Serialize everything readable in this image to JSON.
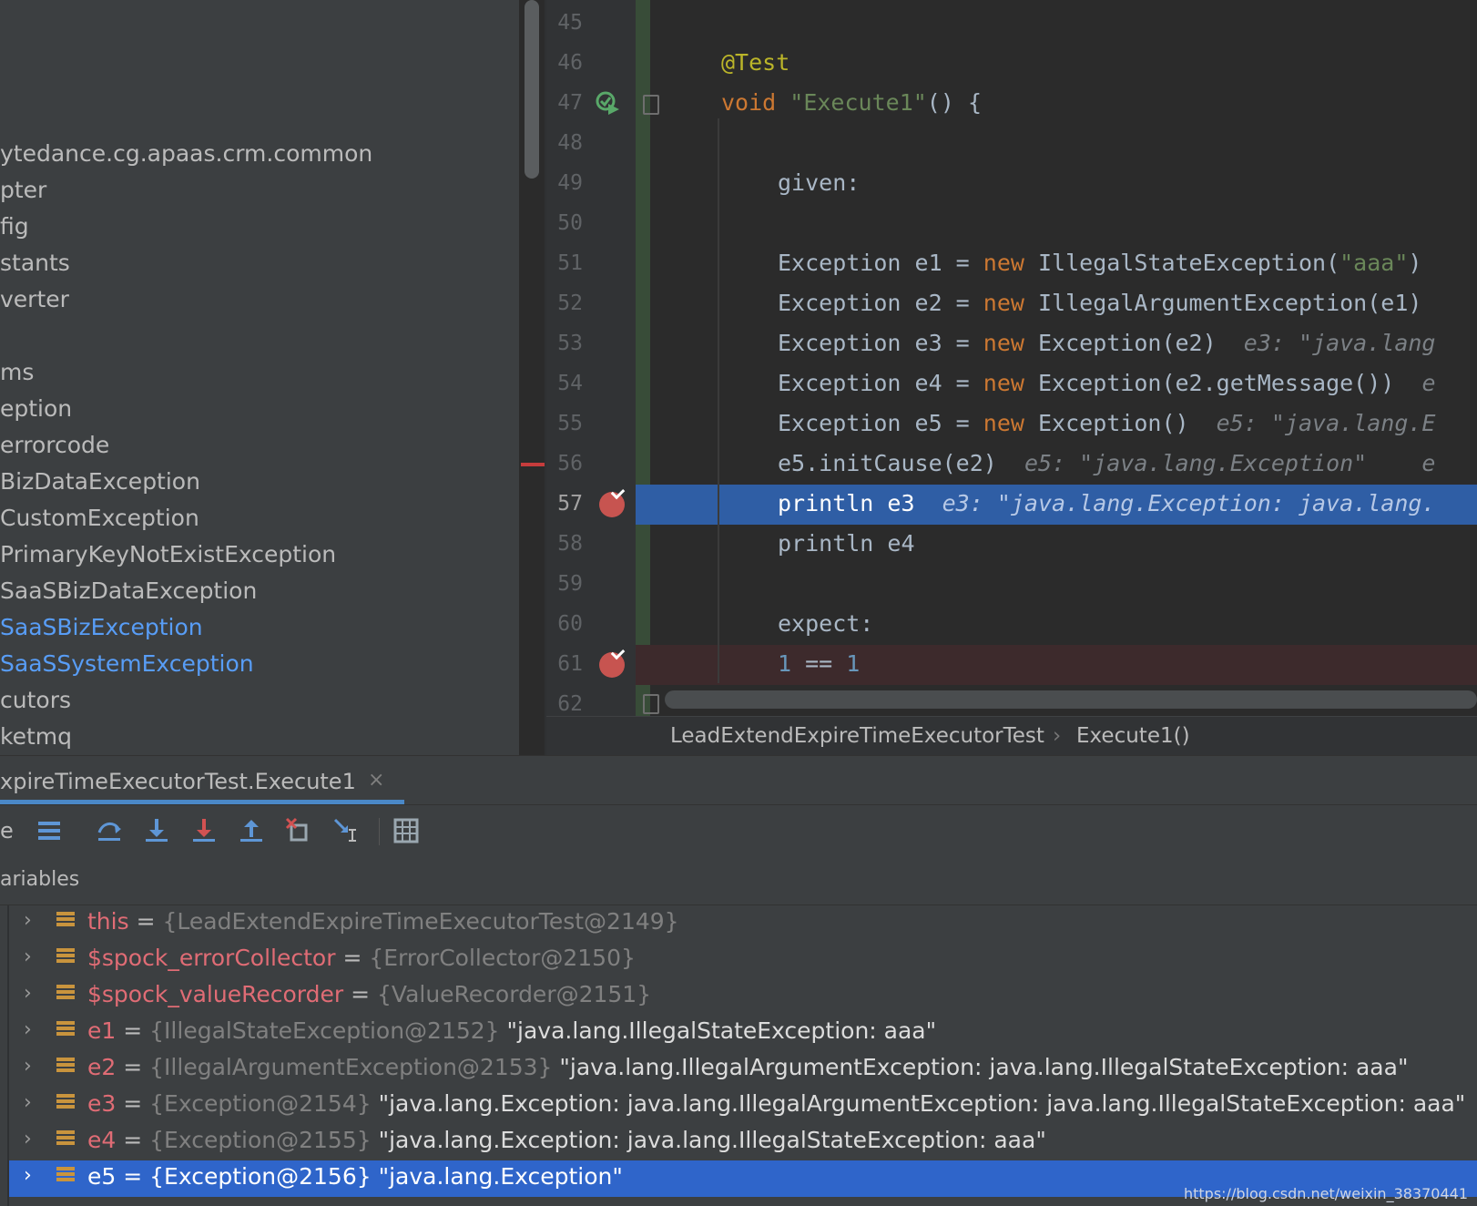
{
  "project_tree": {
    "items": [
      {
        "label": "ytedance.cg.apaas.crm.common",
        "linked": false
      },
      {
        "label": "pter",
        "linked": false
      },
      {
        "label": "fig",
        "linked": false
      },
      {
        "label": "stants",
        "linked": false
      },
      {
        "label": "verter",
        "linked": false
      },
      {
        "label": "",
        "linked": false
      },
      {
        "label": "ms",
        "linked": false
      },
      {
        "label": "eption",
        "linked": false
      },
      {
        "label": "errorcode",
        "linked": false
      },
      {
        "label": "BizDataException",
        "linked": false
      },
      {
        "label": "CustomException",
        "linked": false
      },
      {
        "label": "PrimaryKeyNotExistException",
        "linked": false
      },
      {
        "label": "SaaSBizDataException",
        "linked": false
      },
      {
        "label": "SaaSBizException",
        "linked": true
      },
      {
        "label": "SaaSSystemException",
        "linked": true
      },
      {
        "label": "cutors",
        "linked": false
      },
      {
        "label": "ketmq",
        "linked": false
      }
    ]
  },
  "editor": {
    "lines": [
      {
        "num": "45",
        "code": ""
      },
      {
        "num": "46",
        "code": "@Test"
      },
      {
        "num": "47",
        "code": "void \"Execute1\"() {"
      },
      {
        "num": "48",
        "code": ""
      },
      {
        "num": "49",
        "code": "given:"
      },
      {
        "num": "50",
        "code": ""
      },
      {
        "num": "51",
        "code": "Exception e1 = new IllegalStateException(\"aaa\")"
      },
      {
        "num": "52",
        "code": "Exception e2 = new IllegalArgumentException(e1)"
      },
      {
        "num": "53",
        "code": "Exception e3 = new Exception(e2)",
        "inlay": "e3: \"java.lang"
      },
      {
        "num": "54",
        "code": "Exception e4 = new Exception(e2.getMessage())",
        "inlay": "e"
      },
      {
        "num": "55",
        "code": "Exception e5 = new Exception()",
        "inlay": "e5: \"java.lang.E"
      },
      {
        "num": "56",
        "code": "e5.initCause(e2)",
        "inlay": "e5: \"java.lang.Exception\"    e"
      },
      {
        "num": "57",
        "code": "println e3",
        "inlay": "e3: \"java.lang.Exception: java.lang."
      },
      {
        "num": "58",
        "code": "println e4"
      },
      {
        "num": "59",
        "code": ""
      },
      {
        "num": "60",
        "code": "expect:"
      },
      {
        "num": "61",
        "code": "1 == 1"
      },
      {
        "num": "62",
        "code": ""
      }
    ],
    "colors": {
      "keyword": "#cc7832",
      "string": "#6a8759",
      "annotation": "#bbb529",
      "number": "#6897bb",
      "execution_line": "#2f5ea5",
      "breakpoint": "#c75450"
    }
  },
  "breadcrumb": {
    "class_name": "LeadExtendExpireTimeExecutorTest",
    "separator": "›",
    "method": "Execute1()"
  },
  "debug": {
    "tab_label": "xpireTimeExecutorTest.Execute1",
    "tab_close": "×",
    "toolbar_edge_label": "e",
    "toolbar_icons": [
      "show-execution-point-icon",
      "step-over-icon",
      "step-into-icon",
      "force-step-into-icon",
      "step-out-icon",
      "drop-frame-icon",
      "run-to-cursor-icon",
      "evaluate-expression-icon"
    ],
    "variables_title": "ariables",
    "variables": [
      {
        "name": "this",
        "eq": "=",
        "type": "{LeadExtendExpireTimeExecutorTest@2149}",
        "value": ""
      },
      {
        "name": "$spock_errorCollector",
        "eq": "=",
        "type": "{ErrorCollector@2150}",
        "value": ""
      },
      {
        "name": "$spock_valueRecorder",
        "eq": "=",
        "type": "{ValueRecorder@2151}",
        "value": ""
      },
      {
        "name": "e1",
        "eq": "=",
        "type": "{IllegalStateException@2152}",
        "value": "\"java.lang.IllegalStateException: aaa\""
      },
      {
        "name": "e2",
        "eq": "=",
        "type": "{IllegalArgumentException@2153}",
        "value": "\"java.lang.IllegalArgumentException: java.lang.IllegalStateException: aaa\""
      },
      {
        "name": "e3",
        "eq": "=",
        "type": "{Exception@2154}",
        "value": "\"java.lang.Exception: java.lang.IllegalArgumentException: java.lang.IllegalStateException: aaa\""
      },
      {
        "name": "e4",
        "eq": "=",
        "type": "{Exception@2155}",
        "value": "\"java.lang.Exception: java.lang.IllegalStateException: aaa\""
      },
      {
        "name": "e5",
        "eq": "=",
        "type": "{Exception@2156}",
        "value": "\"java.lang.Exception\""
      }
    ]
  },
  "watermark": "https://blog.csdn.net/weixin_38370441"
}
